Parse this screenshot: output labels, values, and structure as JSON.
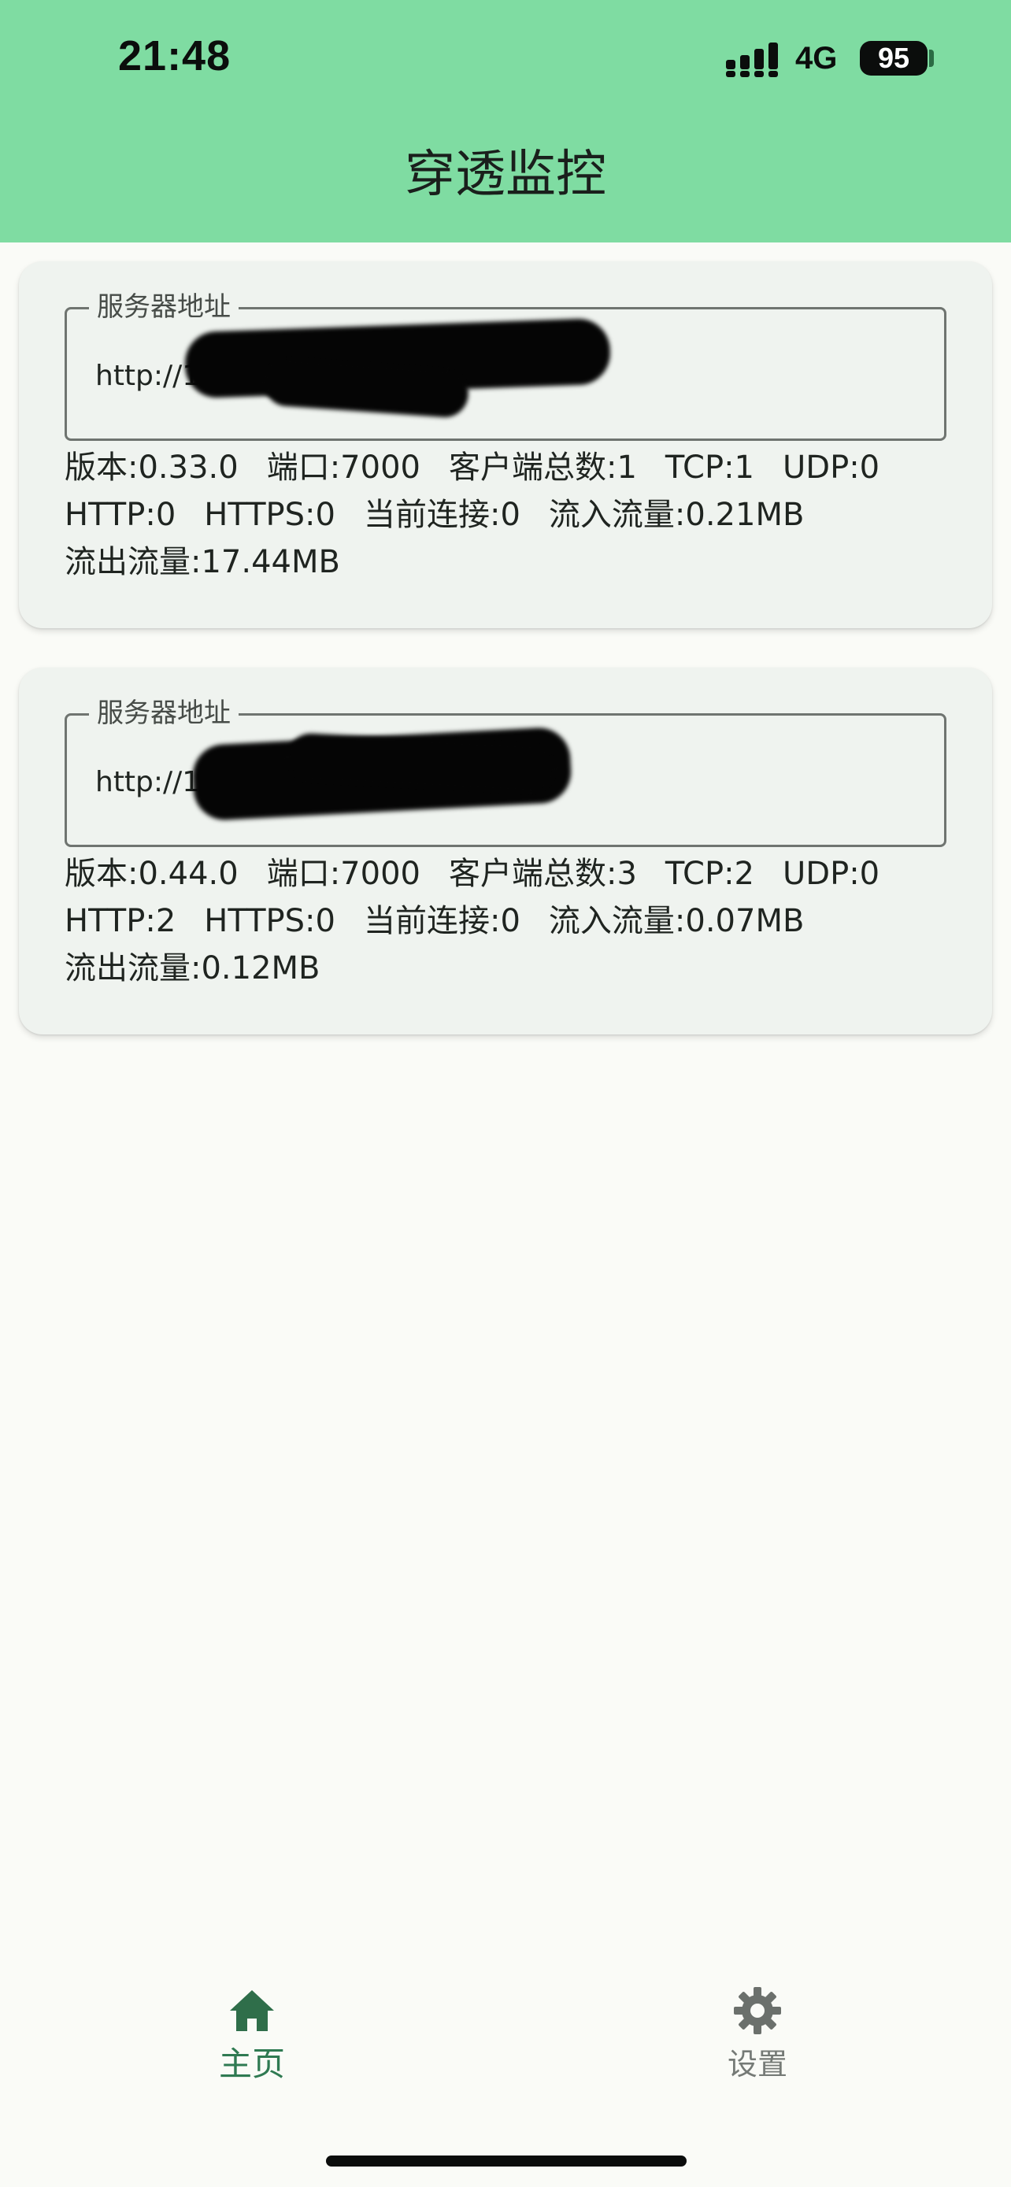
{
  "status_bar": {
    "time": "21:48",
    "network": "4G",
    "battery": "95"
  },
  "app_bar": {
    "title": "穿透监控"
  },
  "servers": [
    {
      "field_label": "服务器地址",
      "address_visible": "http://1",
      "stats": {
        "version": "版本:0.33.0",
        "port": "端口:7000",
        "clients": "客户端总数:1",
        "tcp": "TCP:1",
        "udp": "UDP:0",
        "http": "HTTP:0",
        "https": "HTTPS:0",
        "current_connections": "当前连接:0",
        "inbound": "流入流量:0.21MB",
        "outbound": "流出流量:17.44MB"
      }
    },
    {
      "field_label": "服务器地址",
      "address_visible": "http://1",
      "stats": {
        "version": "版本:0.44.0",
        "port": "端口:7000",
        "clients": "客户端总数:3",
        "tcp": "TCP:2",
        "udp": "UDP:0",
        "http": "HTTP:2",
        "https": "HTTPS:0",
        "current_connections": "当前连接:0",
        "inbound": "流入流量:0.07MB",
        "outbound": "流出流量:0.12MB"
      }
    }
  ],
  "bottom_nav": {
    "items": [
      {
        "label": "主页",
        "icon": "home-icon",
        "active": true
      },
      {
        "label": "设置",
        "icon": "gear-icon",
        "active": false
      }
    ]
  },
  "colors": {
    "app_bar": "#7fdca2",
    "card_background": "#eff3ef",
    "active_nav": "#2f7a52",
    "inactive_nav": "#757a76"
  }
}
